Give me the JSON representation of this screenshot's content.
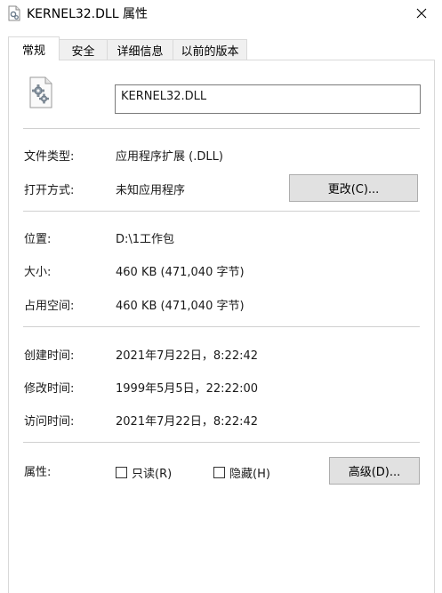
{
  "window": {
    "title": "KERNEL32.DLL 属性"
  },
  "tabs": [
    {
      "label": "常规",
      "active": true
    },
    {
      "label": "安全",
      "active": false
    },
    {
      "label": "详细信息",
      "active": false
    },
    {
      "label": "以前的版本",
      "active": false
    }
  ],
  "general": {
    "file_name": "KERNEL32.DLL",
    "file_type_label": "文件类型:",
    "file_type_value": "应用程序扩展 (.DLL)",
    "opens_with_label": "打开方式:",
    "opens_with_value": "未知应用程序",
    "change_button": "更改(C)...",
    "location_label": "位置:",
    "location_value": "D:\\1工作包",
    "size_label": "大小:",
    "size_value": "460 KB (471,040 字节)",
    "size_on_disk_label": "占用空间:",
    "size_on_disk_value": "460 KB (471,040 字节)",
    "created_label": "创建时间:",
    "created_value": "2021年7月22日，8:22:42",
    "modified_label": "修改时间:",
    "modified_value": "1999年5月5日，22:22:00",
    "accessed_label": "访问时间:",
    "accessed_value": "2021年7月22日，8:22:42",
    "attributes_label": "属性:",
    "readonly_label": "只读(R)",
    "readonly_checked": false,
    "hidden_label": "隐藏(H)",
    "hidden_checked": false,
    "advanced_button": "高级(D)..."
  },
  "icons": {
    "title_icon": "dll-file-icon",
    "file_icon": "gear-file-icon",
    "close_icon": "close-icon"
  }
}
